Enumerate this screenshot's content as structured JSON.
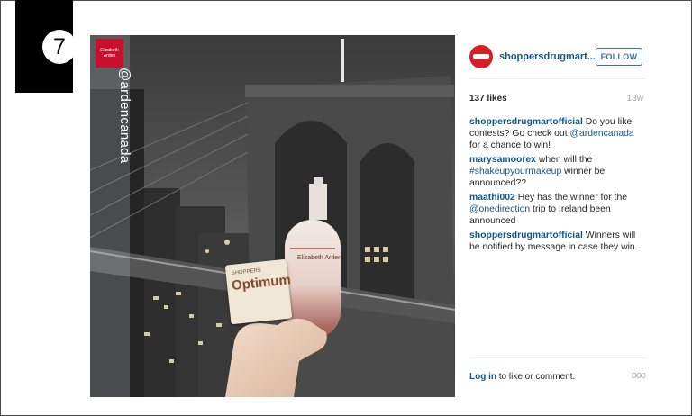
{
  "slide_number": "7",
  "photo": {
    "brand_logo_text": "Elizabeth Arden",
    "handle_overlay": "@ardencanada",
    "card_small": "SHOPPERS",
    "card_big": "Optimum",
    "bottle_brand": "Elizabeth Arden"
  },
  "post": {
    "username": "shoppersdrugmart...",
    "follow_label": "FOLLOW",
    "likes": "137 likes",
    "timestamp": "13w",
    "comments": [
      {
        "author": "shoppersdrugmartofficial",
        "pre": " Do you like contests? Go check out ",
        "link": "@ardencanada",
        "post": " for a chance to win!"
      },
      {
        "author": "marysamoorex",
        "pre": " when will the ",
        "link": "#shakeupyourmakeup",
        "post": " winner be announced??"
      },
      {
        "author": "maathi002",
        "pre": " Hey has the winner for the ",
        "link": "@onedirection",
        "post": " trip to Ireland been announced"
      },
      {
        "author": "shoppersdrugmartofficial",
        "pre": " Winners will be notified by message in case they win.",
        "link": "",
        "post": ""
      }
    ],
    "footer": {
      "login_label": "Log in",
      "login_suffix": " to like or comment.",
      "more_label": "ooo"
    }
  },
  "colors": {
    "accent": "#125688",
    "follow": "#3f729b",
    "avatar": "#d61f26",
    "logo_red": "#c8102e"
  }
}
